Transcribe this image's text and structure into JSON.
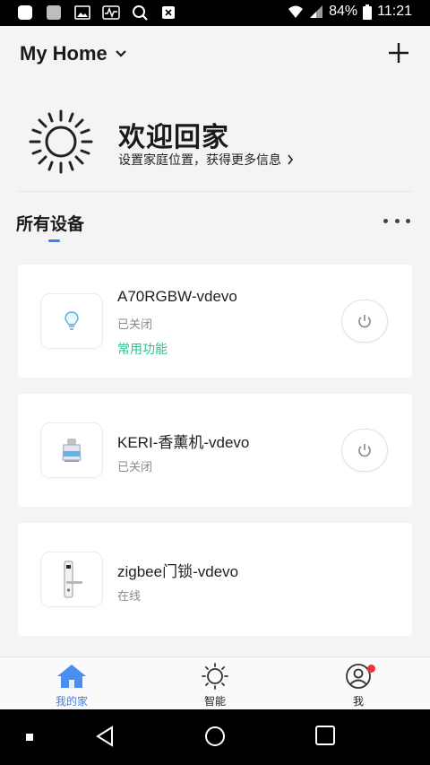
{
  "status_bar": {
    "battery": "84%",
    "time": "11:21"
  },
  "header": {
    "home_title": "My Home"
  },
  "welcome": {
    "title": "欢迎回家",
    "subtitle": "设置家庭位置，获得更多信息"
  },
  "devices_section": {
    "title": "所有设备"
  },
  "devices": [
    {
      "name": "A70RGBW-vdevo",
      "status": "已关闭",
      "function_label": "常用功能"
    },
    {
      "name": "KERI-香薰机-vdevo",
      "status": "已关闭"
    },
    {
      "name": "zigbee门锁-vdevo",
      "status": "在线"
    }
  ],
  "bottom_nav": [
    {
      "label": "我的家"
    },
    {
      "label": "智能"
    },
    {
      "label": "我"
    }
  ],
  "colors": {
    "accent": "#3d7ef0",
    "function_green": "#2fbf8f",
    "badge_red": "#f0323c",
    "background": "#f4f4f6"
  }
}
